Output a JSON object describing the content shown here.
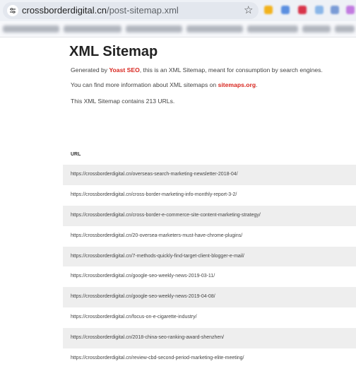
{
  "browser": {
    "url_host": "crossborderdigital.cn",
    "url_path": "/post-sitemap.xml"
  },
  "page": {
    "title": "XML Sitemap",
    "generated_prefix": "Generated by ",
    "generated_link": "Yoast SEO",
    "generated_suffix": ", this is an XML Sitemap, meant for consumption by search engines.",
    "more_info_prefix": "You can find more information about XML sitemaps on ",
    "more_info_link": "sitemaps.org",
    "more_info_suffix": ".",
    "count_text": "This XML Sitemap contains 213 URLs.",
    "column_header": "URL",
    "urls": [
      "https://crossborderdigital.cn/overseas-search-marketing-newsletter-2018-04/",
      "https://crossborderdigital.cn/cross-border-marketing-info-monthly-report-3-2/",
      "https://crossborderdigital.cn/cross-border-e-commerce-site-content-marketing-strategy/",
      "https://crossborderdigital.cn/20-oversea-marketers-must-have-chrome-plugins/",
      "https://crossborderdigital.cn/7-methods-quickly-find-target-client-blogger-e-mail/",
      "https://crossborderdigital.cn/google-seo-weekly-news-2019-03-11/",
      "https://crossborderdigital.cn/google-seo-weekly-news-2019-04-08/",
      "https://crossborderdigital.cn/focus-on-e-cigarette-industry/",
      "https://crossborderdigital.cn/2018-china-seo-ranking-award-shenzhen/",
      "https://crossborderdigital.cn/review-cbd-second-period-marketing-elite-meeting/"
    ]
  },
  "icons": {
    "site_info": "tune-icon",
    "bookmark": "star-icon"
  },
  "colors": {
    "link": "#d8261f",
    "row_shade": "#eeeeee"
  }
}
